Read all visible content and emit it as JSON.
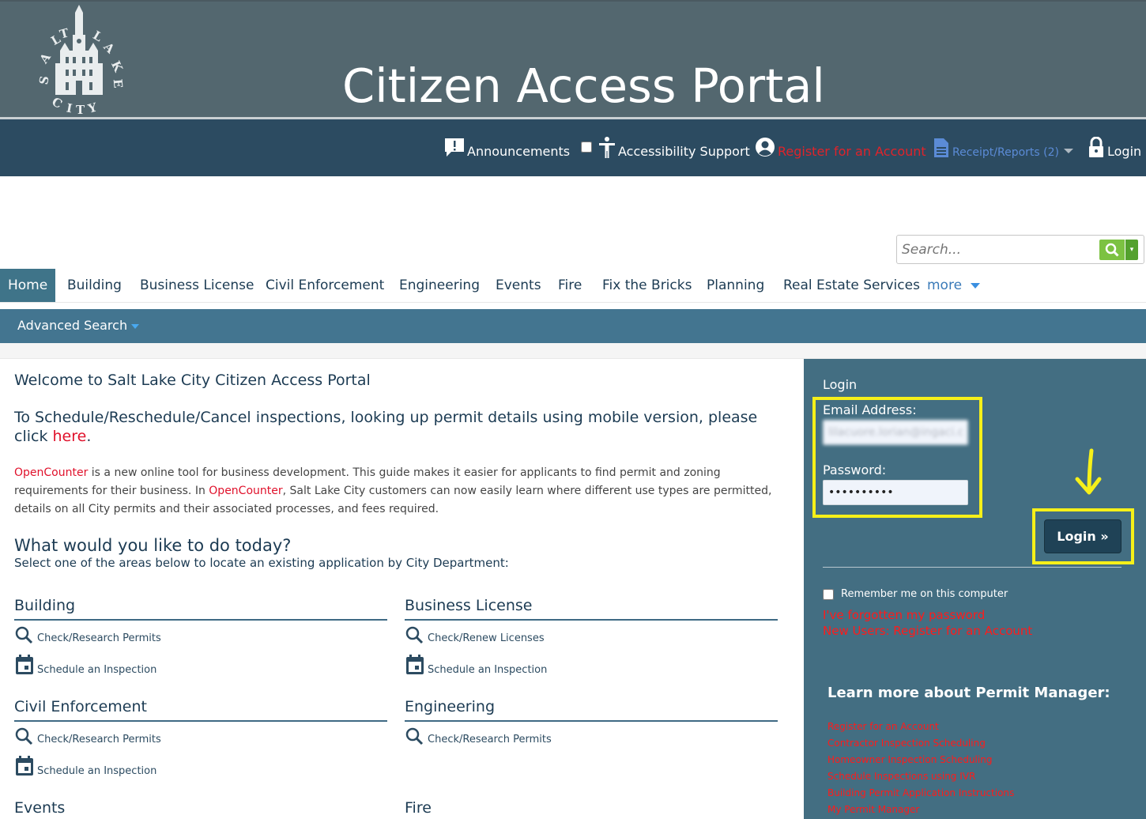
{
  "header": {
    "title": "Citizen Access Portal",
    "logo_text": "SALT LAKE CITY"
  },
  "utility_nav": {
    "announcements": "Announcements",
    "accessibility": "Accessibility Support",
    "register": "Register for an Account",
    "receipts": "Receipt/Reports (2)",
    "login": "Login"
  },
  "search": {
    "placeholder": "Search..."
  },
  "main_nav": {
    "tabs": [
      {
        "label": "Home",
        "active": true
      },
      {
        "label": "Building"
      },
      {
        "label": "Business License"
      },
      {
        "label": "Civil Enforcement"
      },
      {
        "label": "Engineering"
      },
      {
        "label": "Events"
      },
      {
        "label": "Fire"
      },
      {
        "label": "Fix the Bricks"
      },
      {
        "label": "Planning"
      },
      {
        "label": "Real Estate Services"
      }
    ],
    "more": "more"
  },
  "sub_nav": {
    "advanced_search": "Advanced Search"
  },
  "content": {
    "welcome": "Welcome to Salt Lake City Citizen Access Portal",
    "mobile_text": "To Schedule/Reschedule/Cancel inspections, looking up permit details using mobile version, please click ",
    "mobile_link": "here",
    "mobile_period": ".",
    "opencounter_link": "OpenCounter",
    "opencounter_text1": " is a new online tool for business development. This guide makes it easier for applicants to find permit and zoning requirements for their business. In ",
    "opencounter_link2": "OpenCounter",
    "opencounter_text2": ", Salt Lake City customers can now easily learn where different use types are permitted, details on all City permits and their associated processes, and fees required.",
    "question": "What would you like to do today?",
    "select_area": "Select one of the areas below to locate an existing application by City Department:"
  },
  "departments": {
    "building": {
      "title": "Building",
      "link1": "Check/Research Permits",
      "link2": "Schedule an Inspection"
    },
    "business": {
      "title": "Business License",
      "link1": "Check/Renew Licenses",
      "link2": "Schedule an Inspection"
    },
    "civil": {
      "title": "Civil Enforcement",
      "link1": "Check/Research Permits",
      "link2": "Schedule an Inspection"
    },
    "engineering": {
      "title": "Engineering",
      "link1": "Check/Research Permits"
    },
    "events": {
      "title": "Events"
    },
    "fire": {
      "title": "Fire"
    }
  },
  "login_panel": {
    "title": "Login",
    "email_label": "Email Address:",
    "email_value": "lilacuore.lorian@ingaci.com",
    "password_label": "Password:",
    "password_value": "••••••••••",
    "login_button": "Login »",
    "remember": "Remember me on this computer",
    "forgot": "I've forgotten my password",
    "new_users": "New Users: Register for an Account"
  },
  "learn_more": {
    "title": "Learn more about Permit Manager:",
    "links": [
      "Register for an Account",
      "Contractor Inspection Scheduling",
      "Homeowner Inspection Scheduling",
      "Schedule Inspections using IVR",
      "Building Permit Application Instructions",
      "My Permit Manager"
    ]
  },
  "colors": {
    "banner": "#53676f",
    "util_bar": "#2c4b61",
    "nav_blue": "#437590",
    "sidebar": "#436e82",
    "highlight": "#f6f019",
    "link_red": "#e0112b"
  }
}
